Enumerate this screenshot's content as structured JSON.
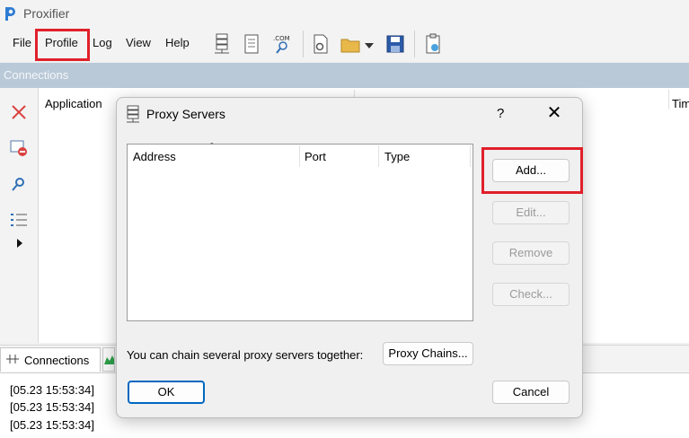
{
  "app": {
    "title": "Proxifier"
  },
  "menu": [
    "File",
    "Profile",
    "Log",
    "View",
    "Help"
  ],
  "toolbar_icons": [
    "proxy-servers-icon",
    "proxification-rules-icon",
    "name-resolution-icon",
    "profile-settings-icon",
    "open-profile-icon",
    "save-profile-icon",
    "check-profile-icon"
  ],
  "connections": {
    "header": "Connections",
    "columns": {
      "application": "Application",
      "time": "Tim"
    }
  },
  "side_icons": [
    "close-icon",
    "remove-connection-icon",
    "find-icon",
    "list-icon",
    "expand-arrow-icon"
  ],
  "tabs": {
    "connections": "Connections"
  },
  "log": [
    "[05.23 15:53:34]",
    "[05.23 15:53:34]",
    "[05.23 15:53:34]"
  ],
  "dialog": {
    "title": "Proxy Servers",
    "help": "?",
    "close": "✕",
    "columns": {
      "address": "Address",
      "sort": "ˆ",
      "port": "Port",
      "type": "Type"
    },
    "buttons": {
      "add": "Add...",
      "edit": "Edit...",
      "remove": "Remove",
      "check": "Check...",
      "chains": "Proxy Chains...",
      "ok": "OK",
      "cancel": "Cancel"
    },
    "chain_label": "You can chain several proxy servers together:"
  },
  "colors": {
    "highlight": "#e0202a",
    "accent": "#0067c0",
    "header": "#b9c9d7"
  }
}
